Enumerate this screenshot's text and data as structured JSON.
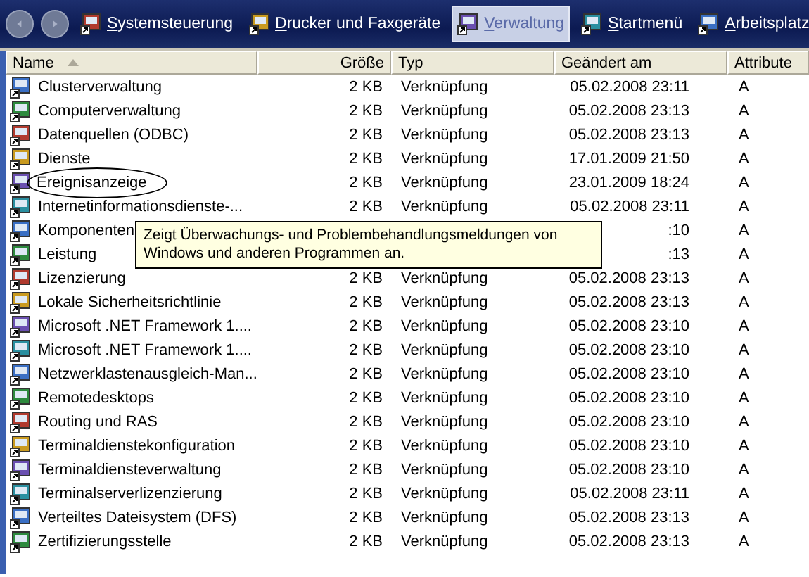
{
  "toolbar": {
    "items": [
      {
        "label": "Systemsteuerung",
        "selected": false
      },
      {
        "label": "Drucker und Faxgeräte",
        "selected": false
      },
      {
        "label": "Verwaltung",
        "selected": true
      },
      {
        "label": "Startmenü",
        "selected": false
      },
      {
        "label": "Arbeitsplatz",
        "selected": false
      }
    ]
  },
  "table": {
    "columns": [
      {
        "label": "Name",
        "sorted": true
      },
      {
        "label": "Größe",
        "sorted": false
      },
      {
        "label": "Typ",
        "sorted": false
      },
      {
        "label": "Geändert am",
        "sorted": false
      },
      {
        "label": "Attribute",
        "sorted": false
      }
    ],
    "rows": [
      {
        "name": "Clusterverwaltung",
        "size": "2 KB",
        "type": "Verknüpfung",
        "modified": "05.02.2008 23:11",
        "attributes": "A",
        "circled": false
      },
      {
        "name": "Computerverwaltung",
        "size": "2 KB",
        "type": "Verknüpfung",
        "modified": "05.02.2008 23:13",
        "attributes": "A",
        "circled": false
      },
      {
        "name": "Datenquellen (ODBC)",
        "size": "2 KB",
        "type": "Verknüpfung",
        "modified": "05.02.2008 23:13",
        "attributes": "A",
        "circled": false
      },
      {
        "name": "Dienste",
        "size": "2 KB",
        "type": "Verknüpfung",
        "modified": "17.01.2009 21:50",
        "attributes": "A",
        "circled": false
      },
      {
        "name": "Ereignisanzeige",
        "size": "2 KB",
        "type": "Verknüpfung",
        "modified": "23.01.2009 18:24",
        "attributes": "A",
        "circled": true
      },
      {
        "name": "Internetinformationsdienste-...",
        "size": "2 KB",
        "type": "Verknüpfung",
        "modified": "05.02.2008 23:11",
        "attributes": "A",
        "circled": false
      },
      {
        "name": "Komponenten",
        "modified": ":10",
        "attributes": "A",
        "circled": false
      },
      {
        "name": "Leistung",
        "modified": ":13",
        "attributes": "A",
        "circled": false
      },
      {
        "name": "Lizenzierung",
        "size": "2 KB",
        "type": "Verknüpfung",
        "modified": "05.02.2008 23:13",
        "attributes": "A",
        "circled": false
      },
      {
        "name": "Lokale Sicherheitsrichtlinie",
        "size": "2 KB",
        "type": "Verknüpfung",
        "modified": "05.02.2008 23:13",
        "attributes": "A",
        "circled": false
      },
      {
        "name": "Microsoft .NET Framework 1....",
        "size": "2 KB",
        "type": "Verknüpfung",
        "modified": "05.02.2008 23:10",
        "attributes": "A",
        "circled": false
      },
      {
        "name": "Microsoft .NET Framework 1....",
        "size": "2 KB",
        "type": "Verknüpfung",
        "modified": "05.02.2008 23:10",
        "attributes": "A",
        "circled": false
      },
      {
        "name": "Netzwerklastenausgleich-Man...",
        "size": "2 KB",
        "type": "Verknüpfung",
        "modified": "05.02.2008 23:10",
        "attributes": "A",
        "circled": false
      },
      {
        "name": "Remotedesktops",
        "size": "2 KB",
        "type": "Verknüpfung",
        "modified": "05.02.2008 23:10",
        "attributes": "A",
        "circled": false
      },
      {
        "name": "Routing und RAS",
        "size": "2 KB",
        "type": "Verknüpfung",
        "modified": "05.02.2008 23:10",
        "attributes": "A",
        "circled": false
      },
      {
        "name": "Terminaldienstekonfiguration",
        "size": "2 KB",
        "type": "Verknüpfung",
        "modified": "05.02.2008 23:10",
        "attributes": "A",
        "circled": false
      },
      {
        "name": "Terminaldiensteverwaltung",
        "size": "2 KB",
        "type": "Verknüpfung",
        "modified": "05.02.2008 23:10",
        "attributes": "A",
        "circled": false
      },
      {
        "name": "Terminalserverlizenzierung",
        "size": "2 KB",
        "type": "Verknüpfung",
        "modified": "05.02.2008 23:11",
        "attributes": "A",
        "circled": false
      },
      {
        "name": "Verteiltes Dateisystem (DFS)",
        "size": "2 KB",
        "type": "Verknüpfung",
        "modified": "05.02.2008 23:13",
        "attributes": "A",
        "circled": false
      },
      {
        "name": "Zertifizierungsstelle",
        "size": "2 KB",
        "type": "Verknüpfung",
        "modified": "05.02.2008 23:13",
        "attributes": "A",
        "circled": false
      }
    ]
  },
  "tooltip": {
    "text": "Zeigt Überwachungs- und Problembehandlungsmeldungen von Windows und anderen Programmen an."
  }
}
